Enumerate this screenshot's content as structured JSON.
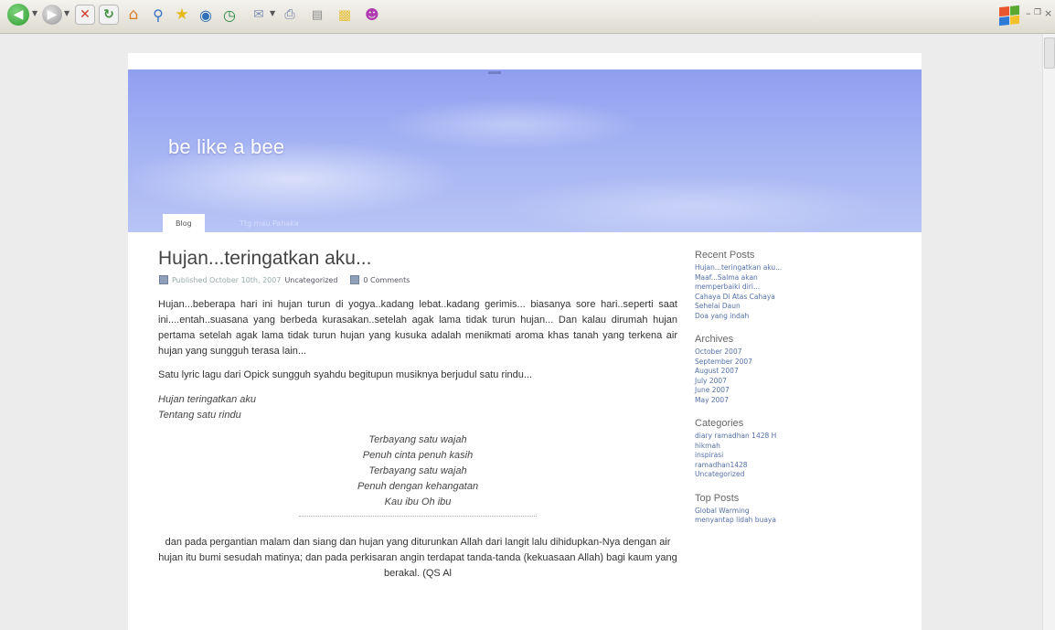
{
  "toolbar": {
    "icons": [
      "back-icon",
      "forward-icon",
      "stop-icon",
      "refresh-icon",
      "home-icon",
      "search-icon",
      "favorites-icon",
      "media-icon",
      "history-icon",
      "mail-icon",
      "print-icon",
      "edit-icon",
      "folder-icon",
      "messenger-icon"
    ],
    "colors": {
      "back": "#2f9e2f",
      "forward": "#9a9a9a",
      "stop": "#d03a2a",
      "refresh": "#3f8f3f",
      "home": "#d9802c"
    }
  },
  "blog": {
    "title": "be like a bee",
    "nav": [
      "Blog",
      "Ttg mau Pahaka"
    ]
  },
  "post": {
    "title": "Hujan...teringatkan aku...",
    "meta_published": "Published October 10th, 2007",
    "meta_category": "Uncategorized",
    "meta_comments": "0 Comments",
    "paragraph1": "Hujan...beberapa hari ini hujan turun di yogya..kadang lebat..kadang gerimis... biasanya sore hari..seperti saat ini....entah..suasana yang berbeda kurasakan..setelah agak lama tidak turun hujan... Dan kalau dirumah hujan pertama setelah agak lama tidak turun hujan yang kusuka adalah menikmati aroma khas tanah yang terkena air hujan yang sungguh terasa lain...",
    "paragraph2": "Satu lyric lagu dari Opick sungguh syahdu begitupun musiknya berjudul satu rindu...",
    "poem_left": [
      "Hujan teringatkan aku",
      "Tentang satu rindu"
    ],
    "poem_center": [
      "Terbayang satu wajah",
      "Penuh cinta penuh kasih",
      "Terbayang satu wajah",
      "Penuh dengan kehangatan",
      "Kau ibu Oh ibu"
    ],
    "paragraph3": "dan pada pergantian malam dan siang dan hujan yang diturunkan Allah dari langit lalu dihidupkan-Nya dengan air hujan itu bumi sesudah matinya; dan pada perkisaran angin terdapat tanda-tanda (kekuasaan Allah) bagi kaum yang berakal. (QS Al"
  },
  "sidebar": {
    "recent_title": "Recent Posts",
    "recent": [
      "Hujan...teringatkan aku...",
      "Maaf...Salma akan",
      "memperbaiki diri...",
      "Cahaya Di Atas Cahaya",
      "Sehelai Daun",
      "Doa yang indah"
    ],
    "archives_title": "Archives",
    "archives": [
      "October 2007",
      "September 2007",
      "August 2007",
      "July 2007",
      "June 2007",
      "May 2007"
    ],
    "categories_title": "Categories",
    "categories": [
      "diary ramadhan 1428 H",
      "hikmah",
      "inspirasi",
      "ramadhan1428",
      "Uncategorized"
    ],
    "top_title": "Top Posts",
    "top": [
      "Global Warming",
      "menyantap lidah buaya"
    ]
  }
}
